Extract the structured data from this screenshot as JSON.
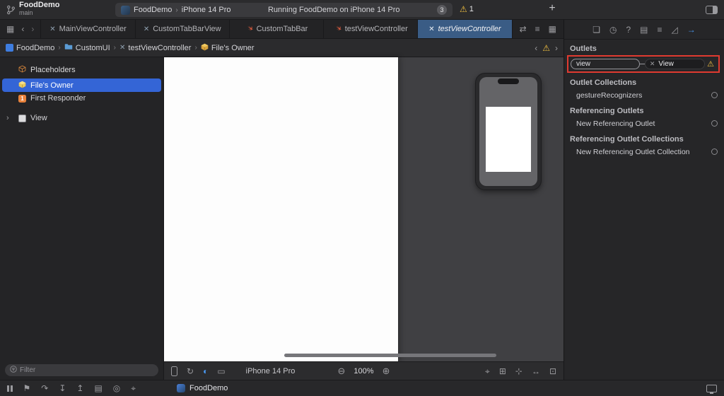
{
  "window": {
    "project": "FoodDemo",
    "branch": "main"
  },
  "toolbar": {
    "scheme": "FoodDemo",
    "run_destination": "iPhone 14 Pro",
    "status": "Running FoodDemo on iPhone 14 Pro",
    "status_count": "3",
    "warning_count": "1"
  },
  "tabbar": {
    "tabs": [
      {
        "label": "MainViewController",
        "kind": "xib"
      },
      {
        "label": "CustomTabBarView",
        "kind": "xib"
      },
      {
        "label": "CustomTabBar",
        "kind": "swift"
      },
      {
        "label": "testViewController",
        "kind": "swift"
      },
      {
        "label": "testViewController",
        "kind": "xib",
        "active": true
      }
    ]
  },
  "jumpbar": {
    "crumbs": [
      "FoodDemo",
      "CustomUI",
      "testViewController",
      "File's Owner"
    ]
  },
  "outline": {
    "group": "Placeholders",
    "items": [
      "File's Owner",
      "First Responder",
      "View"
    ],
    "first_responder_badge": "1",
    "filter_placeholder": "Filter"
  },
  "canvasbar": {
    "device": "iPhone 14 Pro",
    "zoom": "100%"
  },
  "inspector": {
    "outlets_title": "Outlets",
    "outlet_row": {
      "name": "view",
      "target": "View"
    },
    "collections_title": "Outlet Collections",
    "collections_row": "gestureRecognizers",
    "ref_outlets_title": "Referencing Outlets",
    "ref_outlets_row": "New Referencing Outlet",
    "ref_collections_title": "Referencing Outlet Collections",
    "ref_collections_row": "New Referencing Outlet Collection"
  },
  "debugbar": {
    "app": "FoodDemo"
  },
  "colors": {
    "selection_blue": "#3465d6",
    "active_tab_blue": "#3a5c85",
    "warning_yellow": "#f2c040",
    "annotation_red": "#e03a30",
    "swift_orange": "#e05d3f"
  },
  "icons": {
    "separator": "›",
    "chevron_left": "‹",
    "chevron_right": "›",
    "warning": "⚠",
    "xib_file": "✕",
    "related_items": "▦",
    "editor_arrows": "⇄",
    "editor_list": "≡",
    "editor_layout": "▦",
    "plus": "+",
    "disclosure": "›",
    "zoom_out": "⊖",
    "zoom_in": "⊕",
    "close_connection": "✕",
    "file_inspector": "❏",
    "history_inspector": "◷",
    "help_inspector": "?",
    "identity_inspector": "▤",
    "attributes_inspector": "≡",
    "size_inspector": "◿",
    "connections_inspector": "→",
    "orientation": "↻",
    "appearance": "◐",
    "variant": "▭",
    "scope": "⌖",
    "embed": "⊞",
    "align": "⊹",
    "constraints": "↔",
    "resolve": "⊡",
    "flag": "⚑",
    "step_over": "↷",
    "step_into": "↧",
    "step_out": "↥",
    "view_hierarchy": "▤",
    "memory_graph": "◎",
    "location": "⌖"
  }
}
